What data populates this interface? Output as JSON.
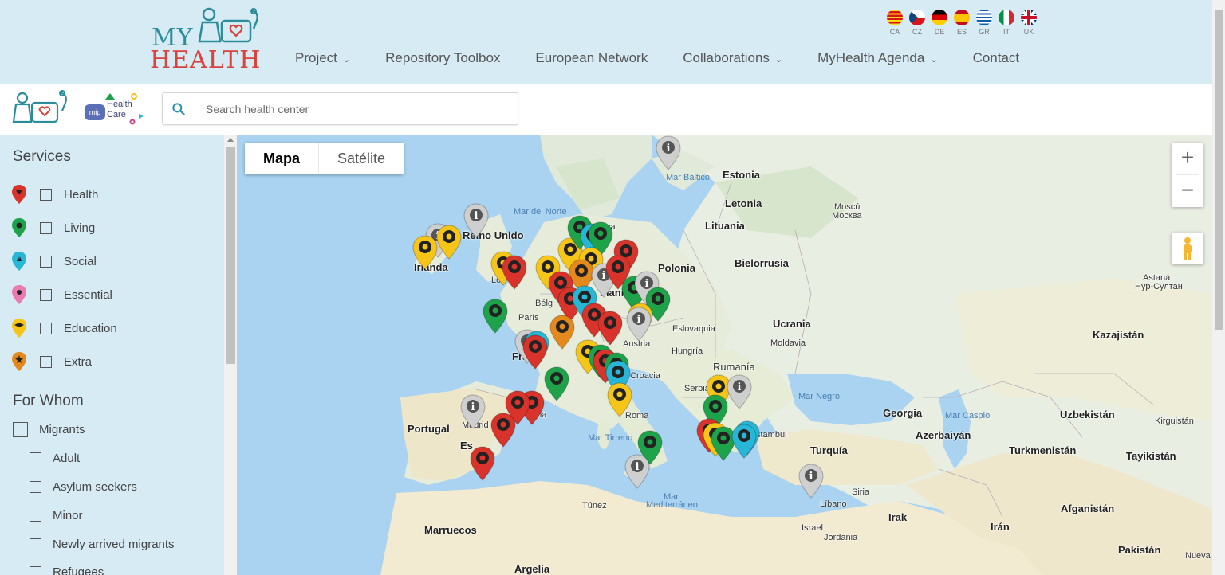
{
  "logo": {
    "line1": "MY",
    "line2": "HEALTH"
  },
  "nav": [
    {
      "label": "Project",
      "dropdown": true
    },
    {
      "label": "Repository Toolbox",
      "dropdown": false
    },
    {
      "label": "European Network",
      "dropdown": false
    },
    {
      "label": "Collaborations",
      "dropdown": true
    },
    {
      "label": "MyHealth Agenda",
      "dropdown": true
    },
    {
      "label": "Contact",
      "dropdown": false
    }
  ],
  "languages": [
    "CA",
    "CZ",
    "DE",
    "ES",
    "GR",
    "IT",
    "UK"
  ],
  "subbar": {
    "partner_logo": {
      "badge": "mip",
      "line1": "Health",
      "line2": "Care"
    },
    "search_placeholder": "Search health center"
  },
  "sidebar": {
    "services_title": "Services",
    "services": [
      {
        "label": "Health",
        "color": "#d9342b",
        "checked": false
      },
      {
        "label": "Living",
        "color": "#1fa34a",
        "checked": false
      },
      {
        "label": "Social",
        "color": "#27b6d6",
        "checked": false
      },
      {
        "label": "Essential",
        "color": "#e97bb0",
        "checked": false
      },
      {
        "label": "Education",
        "color": "#f5c518",
        "checked": false
      },
      {
        "label": "Extra",
        "color": "#e48a1c",
        "checked": false
      }
    ],
    "for_whom_title": "For Whom",
    "migrants_label": "Migrants",
    "migrant_types": [
      "Adult",
      "Asylum seekers",
      "Minor",
      "Newly arrived migrants",
      "Refugees"
    ]
  },
  "map": {
    "map_types": [
      "Mapa",
      "Satélite"
    ],
    "active_type": "Mapa",
    "zoom_in": "+",
    "zoom_out": "−",
    "labels": {
      "estonia": "Estonia",
      "letonia": "Letonia",
      "lituania": "Lituania",
      "bielorrusia": "Bielorrusia",
      "polonia": "Polonia",
      "ucrania": "Ucrania",
      "moldavia": "Moldavia",
      "rumania": "Rumanía",
      "eslovaquia": "Eslovaquia",
      "hungria": "Hungría",
      "austria": "Austria",
      "croacia": "Croacia",
      "serbia": "Serbia",
      "reino_unido": "Reino Unido",
      "irlanda": "Irlanda",
      "belgica": "Bélg",
      "paris": "París",
      "francia": "Fra",
      "alemania": "mania",
      "portugal": "Portugal",
      "madrid": "Madrid",
      "espana": "Es",
      "barcelona": "ona",
      "roma": "Roma",
      "turquia": "Turquía",
      "estambul": "stambul",
      "georgia": "Georgia",
      "azerbaiyan": "Azerbaiyán",
      "uzbekistan": "Uzbekistán",
      "kazajistan": "Kazajistán",
      "kirguistan": "Kirguistán",
      "turkmenistan": "Turkmenistán",
      "tayikistan": "Tayikistán",
      "afganistan": "Afganistán",
      "iran": "Irán",
      "irak": "Irak",
      "siria": "Siria",
      "libano": "Líbano",
      "israel": "Israel",
      "jordania": "Jordania",
      "pakistan": "Pakistán",
      "tunez": "Túnez",
      "marruecos": "Marruecos",
      "argelia": "Argelia",
      "moscu_1": "Moscú",
      "moscu_2": "Москва",
      "astana_1": "Astaná",
      "astana_2": "Нур-Султан",
      "nueva": "Nueva",
      "londres": "Lo",
      "dinamarca": "ca"
    },
    "seas": {
      "baltico": "Mar Báltico",
      "norte": "Mar del Norte",
      "negro": "Mar Negro",
      "caspio": "Mar Caspio",
      "tirreno": "Mar Tirreno",
      "mediterraneo_1": "Mar",
      "mediterraneo_2": "Mediterráneo"
    }
  }
}
